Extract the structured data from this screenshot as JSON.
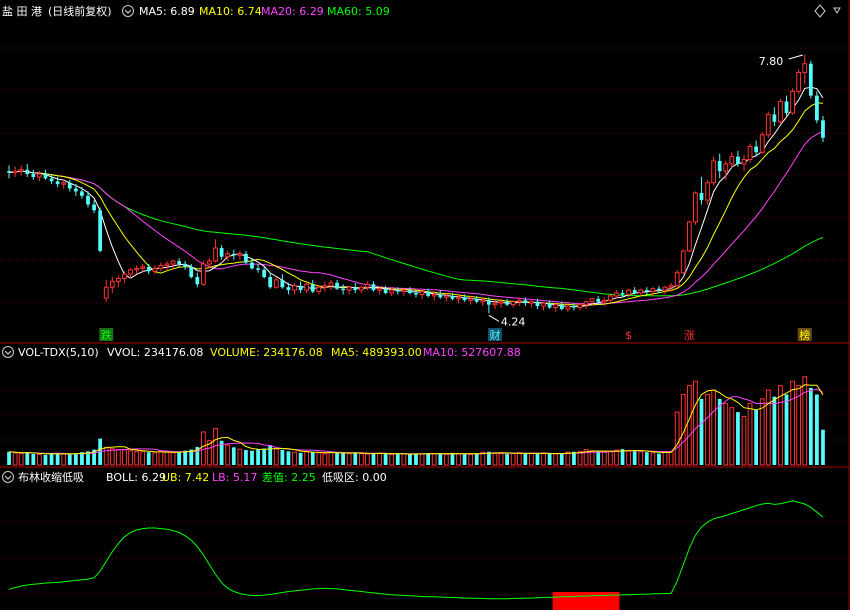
{
  "stock_name": "盐 田 港",
  "adjust_mode": "(日线前复权)",
  "price_panel": {
    "legend": [
      {
        "label": "MA5: 6.89",
        "color": "#ffffff"
      },
      {
        "label": "MA10: 6.74",
        "color": "#ffff00"
      },
      {
        "label": "MA20: 6.29",
        "color": "#ff44ff"
      },
      {
        "label": "MA60: 5.09",
        "color": "#00ff00"
      }
    ],
    "high_label": "7.80",
    "low_label": "4.24",
    "event_markers": [
      "跌",
      "财",
      "$",
      "涨",
      "榜"
    ]
  },
  "volume_panel": {
    "indicator": "VOL-TDX(5,10)",
    "legend": [
      {
        "label": "VVOL: 234176.08",
        "color": "#ffffff"
      },
      {
        "label": "VOLUME: 234176.08",
        "color": "#ffff00"
      },
      {
        "label": "MA5: 489393.00",
        "color": "#ffff00"
      },
      {
        "label": "MA10: 527607.88",
        "color": "#ff44ff"
      }
    ]
  },
  "boll_panel": {
    "indicator": "布林收缩低吸",
    "legend": [
      {
        "label": "BOLL: 6.29",
        "color": "#ffffff"
      },
      {
        "label": "UB: 7.42",
        "color": "#ffff00"
      },
      {
        "label": "LB: 5.17",
        "color": "#ff44ff"
      },
      {
        "label": "差值: 2.25",
        "color": "#00ff00"
      },
      {
        "label": "低吸区: 0.00",
        "color": "#ffffff"
      }
    ]
  },
  "chart_data": {
    "type": "candlestick",
    "colors": {
      "up": "#ff3333",
      "down": "#54fcfc",
      "ma5": "#ffffff",
      "ma10": "#ffff00",
      "ma20": "#ff44ff",
      "ma60": "#00ff00",
      "grid": "#7a0000"
    },
    "price_ylim": [
      3.9,
      8.2
    ],
    "ohlc": [
      [
        6.2,
        6.28,
        6.1,
        6.18
      ],
      [
        6.18,
        6.26,
        6.12,
        6.2
      ],
      [
        6.2,
        6.28,
        6.14,
        6.22
      ],
      [
        6.22,
        6.3,
        6.12,
        6.16
      ],
      [
        6.16,
        6.22,
        6.08,
        6.12
      ],
      [
        6.12,
        6.2,
        6.06,
        6.16
      ],
      [
        6.16,
        6.22,
        6.08,
        6.1
      ],
      [
        6.1,
        6.16,
        6.02,
        6.06
      ],
      [
        6.06,
        6.12,
        5.98,
        6.02
      ],
      [
        6.02,
        6.08,
        5.96,
        6.04
      ],
      [
        6.04,
        6.08,
        5.92,
        5.96
      ],
      [
        5.96,
        6.02,
        5.86,
        5.92
      ],
      [
        5.92,
        5.98,
        5.82,
        5.86
      ],
      [
        5.86,
        5.92,
        5.7,
        5.74
      ],
      [
        5.74,
        5.8,
        5.62,
        5.66
      ],
      [
        5.66,
        5.7,
        5.08,
        5.1
      ],
      [
        4.45,
        4.7,
        4.4,
        4.6
      ],
      [
        4.6,
        4.74,
        4.52,
        4.68
      ],
      [
        4.68,
        4.76,
        4.6,
        4.72
      ],
      [
        4.72,
        4.82,
        4.66,
        4.78
      ],
      [
        4.78,
        4.86,
        4.72,
        4.84
      ],
      [
        4.84,
        4.9,
        4.78,
        4.86
      ],
      [
        4.86,
        4.92,
        4.8,
        4.88
      ],
      [
        4.88,
        4.92,
        4.78,
        4.82
      ],
      [
        4.82,
        4.9,
        4.78,
        4.86
      ],
      [
        4.86,
        4.94,
        4.82,
        4.9
      ],
      [
        4.9,
        4.96,
        4.84,
        4.92
      ],
      [
        4.92,
        4.98,
        4.86,
        4.96
      ],
      [
        4.96,
        5.0,
        4.88,
        4.92
      ],
      [
        4.92,
        4.96,
        4.84,
        4.88
      ],
      [
        4.88,
        4.92,
        4.72,
        4.74
      ],
      [
        4.74,
        4.8,
        4.6,
        4.64
      ],
      [
        4.64,
        4.96,
        4.62,
        4.92
      ],
      [
        4.92,
        5.0,
        4.86,
        4.96
      ],
      [
        4.96,
        5.26,
        4.94,
        5.14
      ],
      [
        5.14,
        5.18,
        4.98,
        5.02
      ],
      [
        5.02,
        5.1,
        4.96,
        5.06
      ],
      [
        5.06,
        5.12,
        4.98,
        5.04
      ],
      [
        5.04,
        5.1,
        4.98,
        5.06
      ],
      [
        5.06,
        5.1,
        4.92,
        4.94
      ],
      [
        4.94,
        5.0,
        4.84,
        4.86
      ],
      [
        4.86,
        4.92,
        4.8,
        4.84
      ],
      [
        4.84,
        4.88,
        4.72,
        4.74
      ],
      [
        4.74,
        4.8,
        4.58,
        4.6
      ],
      [
        4.6,
        4.74,
        4.58,
        4.7
      ],
      [
        4.7,
        4.78,
        4.58,
        4.6
      ],
      [
        4.6,
        4.66,
        4.5,
        4.56
      ],
      [
        4.56,
        4.66,
        4.5,
        4.62
      ],
      [
        4.62,
        4.68,
        4.52,
        4.56
      ],
      [
        4.56,
        4.66,
        4.52,
        4.64
      ],
      [
        4.64,
        4.7,
        4.52,
        4.54
      ],
      [
        4.54,
        4.62,
        4.5,
        4.6
      ],
      [
        4.6,
        4.68,
        4.54,
        4.62
      ],
      [
        4.62,
        4.7,
        4.56,
        4.66
      ],
      [
        4.66,
        4.7,
        4.56,
        4.58
      ],
      [
        4.58,
        4.64,
        4.5,
        4.56
      ],
      [
        4.56,
        4.62,
        4.5,
        4.6
      ],
      [
        4.6,
        4.66,
        4.52,
        4.56
      ],
      [
        4.56,
        4.62,
        4.52,
        4.6
      ],
      [
        4.6,
        4.68,
        4.56,
        4.64
      ],
      [
        4.64,
        4.68,
        4.54,
        4.56
      ],
      [
        4.56,
        4.6,
        4.5,
        4.58
      ],
      [
        4.58,
        4.62,
        4.5,
        4.52
      ],
      [
        4.52,
        4.6,
        4.48,
        4.56
      ],
      [
        4.56,
        4.6,
        4.5,
        4.54
      ],
      [
        4.54,
        4.58,
        4.48,
        4.56
      ],
      [
        4.56,
        4.6,
        4.5,
        4.52
      ],
      [
        4.52,
        4.56,
        4.46,
        4.5
      ],
      [
        4.5,
        4.56,
        4.44,
        4.54
      ],
      [
        4.54,
        4.58,
        4.46,
        4.48
      ],
      [
        4.48,
        4.54,
        4.42,
        4.5
      ],
      [
        4.5,
        4.56,
        4.44,
        4.46
      ],
      [
        4.46,
        4.52,
        4.4,
        4.48
      ],
      [
        4.48,
        4.52,
        4.42,
        4.44
      ],
      [
        4.44,
        4.5,
        4.38,
        4.46
      ],
      [
        4.46,
        4.5,
        4.4,
        4.42
      ],
      [
        4.42,
        4.48,
        4.36,
        4.44
      ],
      [
        4.44,
        4.48,
        4.38,
        4.4
      ],
      [
        4.4,
        4.46,
        4.34,
        4.42
      ],
      [
        4.42,
        4.46,
        4.24,
        4.36
      ],
      [
        4.36,
        4.42,
        4.3,
        4.38
      ],
      [
        4.38,
        4.44,
        4.32,
        4.4
      ],
      [
        4.4,
        4.44,
        4.34,
        4.36
      ],
      [
        4.36,
        4.42,
        4.32,
        4.4
      ],
      [
        4.4,
        4.46,
        4.34,
        4.42
      ],
      [
        4.42,
        4.46,
        4.34,
        4.38
      ],
      [
        4.38,
        4.42,
        4.32,
        4.4
      ],
      [
        4.4,
        4.44,
        4.3,
        4.34
      ],
      [
        4.34,
        4.4,
        4.28,
        4.38
      ],
      [
        4.38,
        4.42,
        4.3,
        4.32
      ],
      [
        4.32,
        4.38,
        4.26,
        4.36
      ],
      [
        4.36,
        4.4,
        4.28,
        4.3
      ],
      [
        4.3,
        4.36,
        4.26,
        4.34
      ],
      [
        4.34,
        4.38,
        4.28,
        4.32
      ],
      [
        4.32,
        4.38,
        4.28,
        4.36
      ],
      [
        4.36,
        4.42,
        4.3,
        4.4
      ],
      [
        4.4,
        4.46,
        4.34,
        4.44
      ],
      [
        4.44,
        4.48,
        4.36,
        4.4
      ],
      [
        4.4,
        4.46,
        4.34,
        4.42
      ],
      [
        4.42,
        4.5,
        4.38,
        4.48
      ],
      [
        4.48,
        4.56,
        4.44,
        4.52
      ],
      [
        4.52,
        4.56,
        4.46,
        4.5
      ],
      [
        4.5,
        4.58,
        4.46,
        4.56
      ],
      [
        4.56,
        4.6,
        4.5,
        4.52
      ],
      [
        4.52,
        4.58,
        4.48,
        4.56
      ],
      [
        4.56,
        4.6,
        4.5,
        4.54
      ],
      [
        4.54,
        4.6,
        4.48,
        4.58
      ],
      [
        4.58,
        4.62,
        4.52,
        4.56
      ],
      [
        4.56,
        4.62,
        4.5,
        4.6
      ],
      [
        4.6,
        4.66,
        4.54,
        4.62
      ],
      [
        4.62,
        4.84,
        4.6,
        4.8
      ],
      [
        4.8,
        5.12,
        4.78,
        5.1
      ],
      [
        5.1,
        5.52,
        5.08,
        5.5
      ],
      [
        5.5,
        5.92,
        5.46,
        5.9
      ],
      [
        5.9,
        6.12,
        5.74,
        5.8
      ],
      [
        5.8,
        6.08,
        5.74,
        6.04
      ],
      [
        6.04,
        6.4,
        6.0,
        6.34
      ],
      [
        6.34,
        6.44,
        6.1,
        6.2
      ],
      [
        6.2,
        6.34,
        6.08,
        6.3
      ],
      [
        6.3,
        6.46,
        6.24,
        6.4
      ],
      [
        6.4,
        6.48,
        6.26,
        6.3
      ],
      [
        6.3,
        6.42,
        6.2,
        6.36
      ],
      [
        6.36,
        6.58,
        6.32,
        6.54
      ],
      [
        6.54,
        6.62,
        6.4,
        6.46
      ],
      [
        6.46,
        6.74,
        6.44,
        6.7
      ],
      [
        6.7,
        7.02,
        6.66,
        6.98
      ],
      [
        6.98,
        7.08,
        6.82,
        6.88
      ],
      [
        6.88,
        7.2,
        6.86,
        7.16
      ],
      [
        7.16,
        7.24,
        6.96,
        7.0
      ],
      [
        7.0,
        7.34,
        6.98,
        7.3
      ],
      [
        7.3,
        7.6,
        7.26,
        7.56
      ],
      [
        7.56,
        7.8,
        7.4,
        7.68
      ],
      [
        7.68,
        7.72,
        7.2,
        7.24
      ],
      [
        7.24,
        7.3,
        6.86,
        6.9
      ],
      [
        6.9,
        6.96,
        6.6,
        6.66
      ]
    ],
    "volume": [
      60,
      55,
      52,
      58,
      50,
      48,
      46,
      52,
      55,
      50,
      48,
      52,
      58,
      62,
      70,
      120,
      80,
      75,
      70,
      68,
      65,
      62,
      60,
      58,
      55,
      62,
      58,
      56,
      60,
      65,
      70,
      82,
      150,
      110,
      165,
      110,
      90,
      80,
      72,
      68,
      65,
      70,
      75,
      90,
      72,
      68,
      62,
      58,
      55,
      60,
      58,
      55,
      52,
      58,
      56,
      54,
      52,
      55,
      52,
      50,
      52,
      54,
      50,
      48,
      52,
      50,
      48,
      52,
      50,
      54,
      52,
      50,
      48,
      55,
      52,
      50,
      48,
      52,
      58,
      60,
      55,
      52,
      50,
      52,
      56,
      54,
      52,
      50,
      55,
      52,
      50,
      52,
      58,
      60,
      62,
      70,
      65,
      60,
      58,
      62,
      68,
      72,
      65,
      62,
      60,
      58,
      55,
      52,
      58,
      62,
      240,
      320,
      360,
      380,
      300,
      320,
      340,
      300,
      280,
      260,
      240,
      220,
      280,
      250,
      300,
      340,
      310,
      360,
      320,
      380,
      360,
      400,
      350,
      320,
      160
    ],
    "vol_ylim": [
      0,
      440
    ],
    "boll_width": [
      1.35,
      1.4,
      1.45,
      1.48,
      1.5,
      1.52,
      1.54,
      1.55,
      1.56,
      1.58,
      1.6,
      1.62,
      1.64,
      1.66,
      1.7,
      1.9,
      2.2,
      2.5,
      2.75,
      2.95,
      3.08,
      3.16,
      3.2,
      3.22,
      3.22,
      3.2,
      3.18,
      3.14,
      3.08,
      2.98,
      2.85,
      2.65,
      2.4,
      2.1,
      1.8,
      1.55,
      1.38,
      1.28,
      1.22,
      1.18,
      1.16,
      1.16,
      1.17,
      1.19,
      1.22,
      1.25,
      1.28,
      1.3,
      1.32,
      1.34,
      1.36,
      1.37,
      1.38,
      1.37,
      1.36,
      1.34,
      1.32,
      1.3,
      1.28,
      1.26,
      1.24,
      1.22,
      1.2,
      1.18,
      1.17,
      1.16,
      1.15,
      1.14,
      1.13,
      1.12,
      1.12,
      1.11,
      1.1,
      1.1,
      1.09,
      1.08,
      1.08,
      1.07,
      1.07,
      1.06,
      1.06,
      1.06,
      1.06,
      1.07,
      1.07,
      1.08,
      1.08,
      1.09,
      1.1,
      1.1,
      1.11,
      1.12,
      1.12,
      1.13,
      1.14,
      1.14,
      1.15,
      1.16,
      1.16,
      1.17,
      1.17,
      1.18,
      1.18,
      1.19,
      1.2,
      1.2,
      1.21,
      1.21,
      1.22,
      1.22,
      1.6,
      2.1,
      2.6,
      3.0,
      3.25,
      3.4,
      3.5,
      3.55,
      3.6,
      3.66,
      3.72,
      3.78,
      3.84,
      3.9,
      3.95,
      3.97,
      3.94,
      3.96,
      4.0,
      4.05,
      4.0,
      3.95,
      3.85,
      3.7,
      3.55
    ],
    "boll_ylim": [
      0.9,
      4.5
    ],
    "low_buy_zone_index": [
      90,
      100
    ],
    "event_marker_index": [
      16,
      80,
      102,
      112,
      131
    ]
  }
}
